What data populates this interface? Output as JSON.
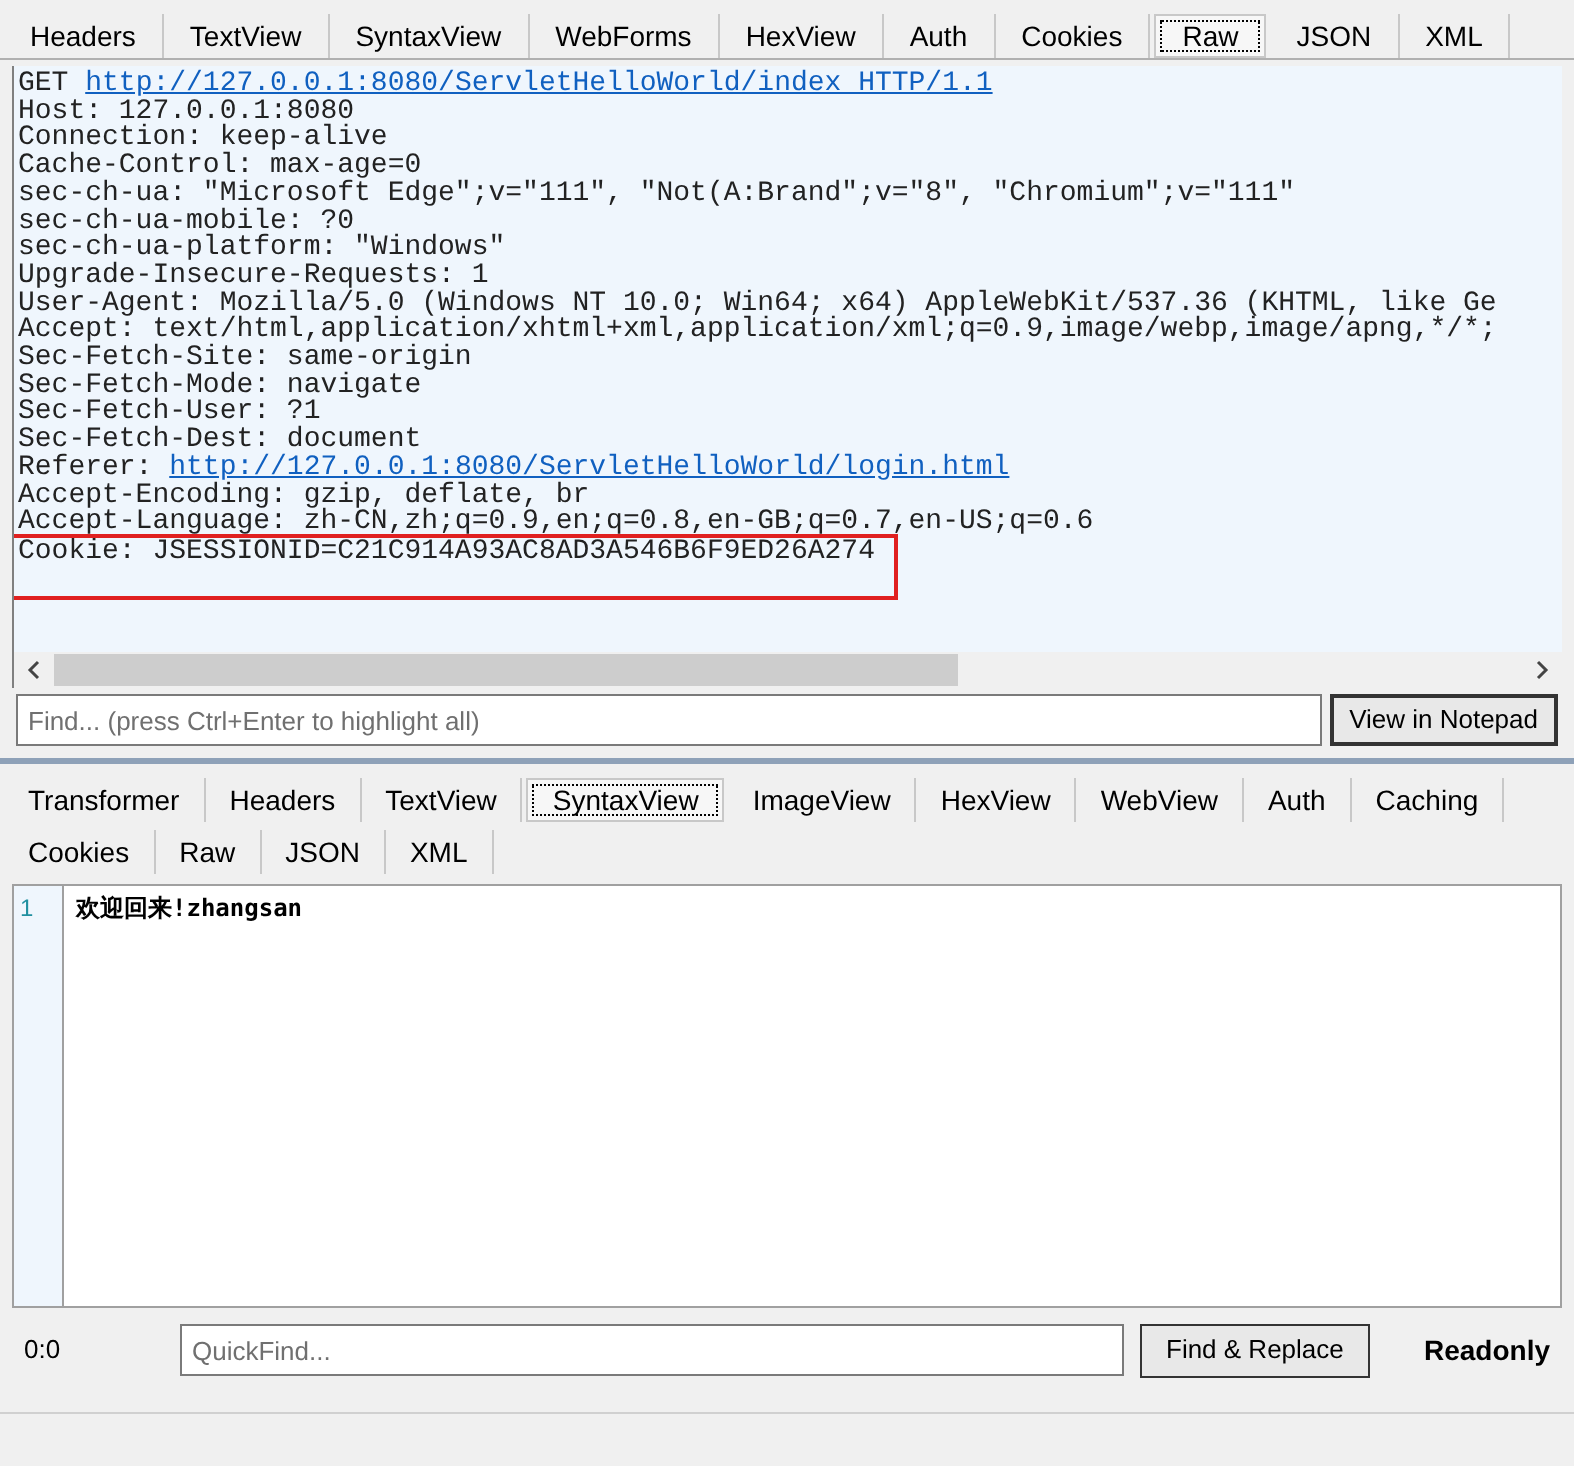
{
  "request_tabs": [
    {
      "label": "Headers",
      "selected": false
    },
    {
      "label": "TextView",
      "selected": false
    },
    {
      "label": "SyntaxView",
      "selected": false
    },
    {
      "label": "WebForms",
      "selected": false
    },
    {
      "label": "HexView",
      "selected": false
    },
    {
      "label": "Auth",
      "selected": false
    },
    {
      "label": "Cookies",
      "selected": false
    },
    {
      "label": "Raw",
      "selected": true
    },
    {
      "label": "JSON",
      "selected": false
    },
    {
      "label": "XML",
      "selected": false
    }
  ],
  "raw_request": [
    {
      "text": "GET ",
      "link": "http://127.0.0.1:8080/ServletHelloWorld/index HTTP/1.1",
      "highlighted": false
    },
    {
      "text": "Host: 127.0.0.1:8080",
      "highlighted": false
    },
    {
      "text": "Connection: keep-alive",
      "highlighted": false
    },
    {
      "text": "Cache-Control: max-age=0",
      "highlighted": false
    },
    {
      "text": "sec-ch-ua: \"Microsoft Edge\";v=\"111\", \"Not(A:Brand\";v=\"8\", \"Chromium\";v=\"111\"",
      "highlighted": false
    },
    {
      "text": "sec-ch-ua-mobile: ?0",
      "highlighted": false
    },
    {
      "text": "sec-ch-ua-platform: \"Windows\"",
      "highlighted": false
    },
    {
      "text": "Upgrade-Insecure-Requests: 1",
      "highlighted": false
    },
    {
      "text": "User-Agent: Mozilla/5.0 (Windows NT 10.0; Win64; x64) AppleWebKit/537.36 (KHTML, like Ge",
      "highlighted": false
    },
    {
      "text": "Accept: text/html,application/xhtml+xml,application/xml;q=0.9,image/webp,image/apng,*/*;",
      "highlighted": false
    },
    {
      "text": "Sec-Fetch-Site: same-origin",
      "highlighted": false
    },
    {
      "text": "Sec-Fetch-Mode: navigate",
      "highlighted": false
    },
    {
      "text": "Sec-Fetch-User: ?1",
      "highlighted": false
    },
    {
      "text": "Sec-Fetch-Dest: document",
      "highlighted": false
    },
    {
      "text": "Referer: ",
      "link": "http://127.0.0.1:8080/ServletHelloWorld/login.html",
      "highlighted": false
    },
    {
      "text": "Accept-Encoding: gzip, deflate, br",
      "highlighted": false
    },
    {
      "text": "Accept-Language: zh-CN,zh;q=0.9,en;q=0.8,en-GB;q=0.7,en-US;q=0.6",
      "highlighted": false
    },
    {
      "text": "Cookie: JSESSIONID=C21C914A93AC8AD3A546B6F9ED26A274",
      "highlighted": true
    }
  ],
  "find": {
    "placeholder": "Find... (press Ctrl+Enter to highlight all)",
    "button": "View in Notepad"
  },
  "response_tab_rows": [
    {
      "tabs": [
        {
          "label": "Transformer",
          "selected": false
        },
        {
          "label": "Headers",
          "selected": false
        },
        {
          "label": "TextView",
          "selected": false
        },
        {
          "label": "SyntaxView",
          "selected": true
        },
        {
          "label": "ImageView",
          "selected": false
        },
        {
          "label": "HexView",
          "selected": false
        },
        {
          "label": "WebView",
          "selected": false
        },
        {
          "label": "Auth",
          "selected": false
        },
        {
          "label": "Caching",
          "selected": false
        }
      ]
    },
    {
      "tabs": [
        {
          "label": "Cookies",
          "selected": false
        },
        {
          "label": "Raw",
          "selected": false
        },
        {
          "label": "JSON",
          "selected": false
        },
        {
          "label": "XML",
          "selected": false
        }
      ]
    }
  ],
  "response_body": [
    {
      "number": "1",
      "text": "欢迎回来!zhangsan"
    }
  ],
  "editor_bar": {
    "position": "0:0",
    "quickfind_placeholder": "QuickFind...",
    "button": "Find & Replace",
    "mode": "Readonly"
  }
}
